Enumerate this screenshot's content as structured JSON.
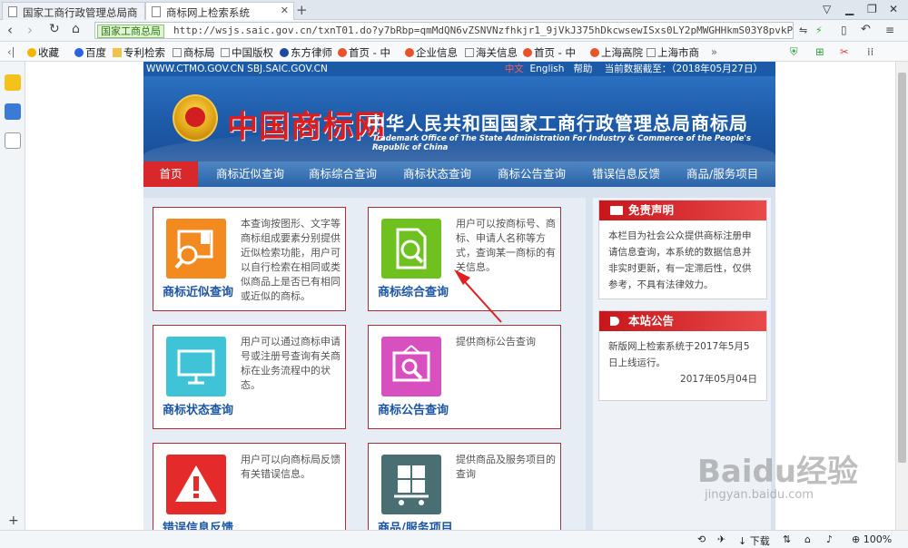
{
  "browser": {
    "tabs": [
      {
        "title": "国家工商行政管理总局商"
      },
      {
        "title": "商标网上检索系统"
      }
    ],
    "new_tab": "+",
    "site_badge": "国家工商总局",
    "url": "http://wsjs.saic.gov.cn/txnT01.do?y7bRbp=qmMdQN6vZSNVNzfhkjr1_9jVkJ375hDkcwsewISxs0LY2pMWGHHkmS03Y8pvkPI3h.bPIiLYZCZs8_I",
    "bookmarks": [
      "收藏",
      "百度",
      "专利检索",
      "商标局",
      "中国版权",
      "东方律师",
      "首页 - 中",
      "企业信息",
      "海关信息",
      "首页 - 中",
      "上海高院",
      "上海市商"
    ],
    "bookmarks_more": "»",
    "status": {
      "download": "下载",
      "zoom": "100%"
    }
  },
  "site": {
    "top_url": "WWW.CTMO.GOV.CN SBJ.SAIC.GOV.CN",
    "top_links": {
      "lang_cn": "中文",
      "lang_en": "English",
      "help": "帮助",
      "data_date": "当前数据截至：（2018年05月27日）"
    },
    "logo_text": "中国商标网",
    "org_name": "中华人民共和国国家工商行政管理总局商标局",
    "org_en": "Trademark Office of The State Administration For Industry & Commerce of the People's Republic of China",
    "nav": [
      "首页",
      "商标近似查询",
      "商标综合查询",
      "商标状态查询",
      "商标公告查询",
      "错误信息反馈",
      "商品/服务项目"
    ],
    "cards": [
      {
        "title": "商标近似查询",
        "desc": "本查询按图形、文字等商标组成要素分别提供近似检索功能，用户可以自行检索在相同或类似商品上是否已有相同或近似的商标。",
        "color": "#f28a1f",
        "icon": "folder-search-icon"
      },
      {
        "title": "商标综合查询",
        "desc": "用户可以按商标号、商标、申请人名称等方式，查询某一商标的有关信息。",
        "color": "#6ec11f",
        "icon": "document-search-icon"
      },
      {
        "title": "商标状态查询",
        "desc": "用户可以通过商标申请号或注册号查询有关商标在业务流程中的状态。",
        "color": "#3fc3d7",
        "icon": "monitor-icon"
      },
      {
        "title": "商标公告查询",
        "desc": "提供商标公告查询",
        "color": "#d84fc0",
        "icon": "board-search-icon"
      },
      {
        "title": "错误信息反馈",
        "desc": "用户可以向商标局反馈有关错误信息。",
        "color": "#e52a2a",
        "icon": "warning-icon"
      },
      {
        "title": "商品/服务项目",
        "desc": "提供商品及服务项目的查询",
        "color": "#4a6f73",
        "icon": "cart-icon"
      }
    ],
    "disclaimer": {
      "title": "免责声明",
      "text": "本栏目为社会公众提供商标注册申请信息查询，本系统的数据信息并非实时更新，有一定滞后性，仅供参考，不具有法律效力。"
    },
    "announcement": {
      "title": "本站公告",
      "text": "新版网上检索系统于2017年5月5日上线运行。",
      "date": "2017年05月04日"
    }
  },
  "watermark": {
    "brand": "Baidu经验",
    "url": "jingyan.baidu.com"
  }
}
